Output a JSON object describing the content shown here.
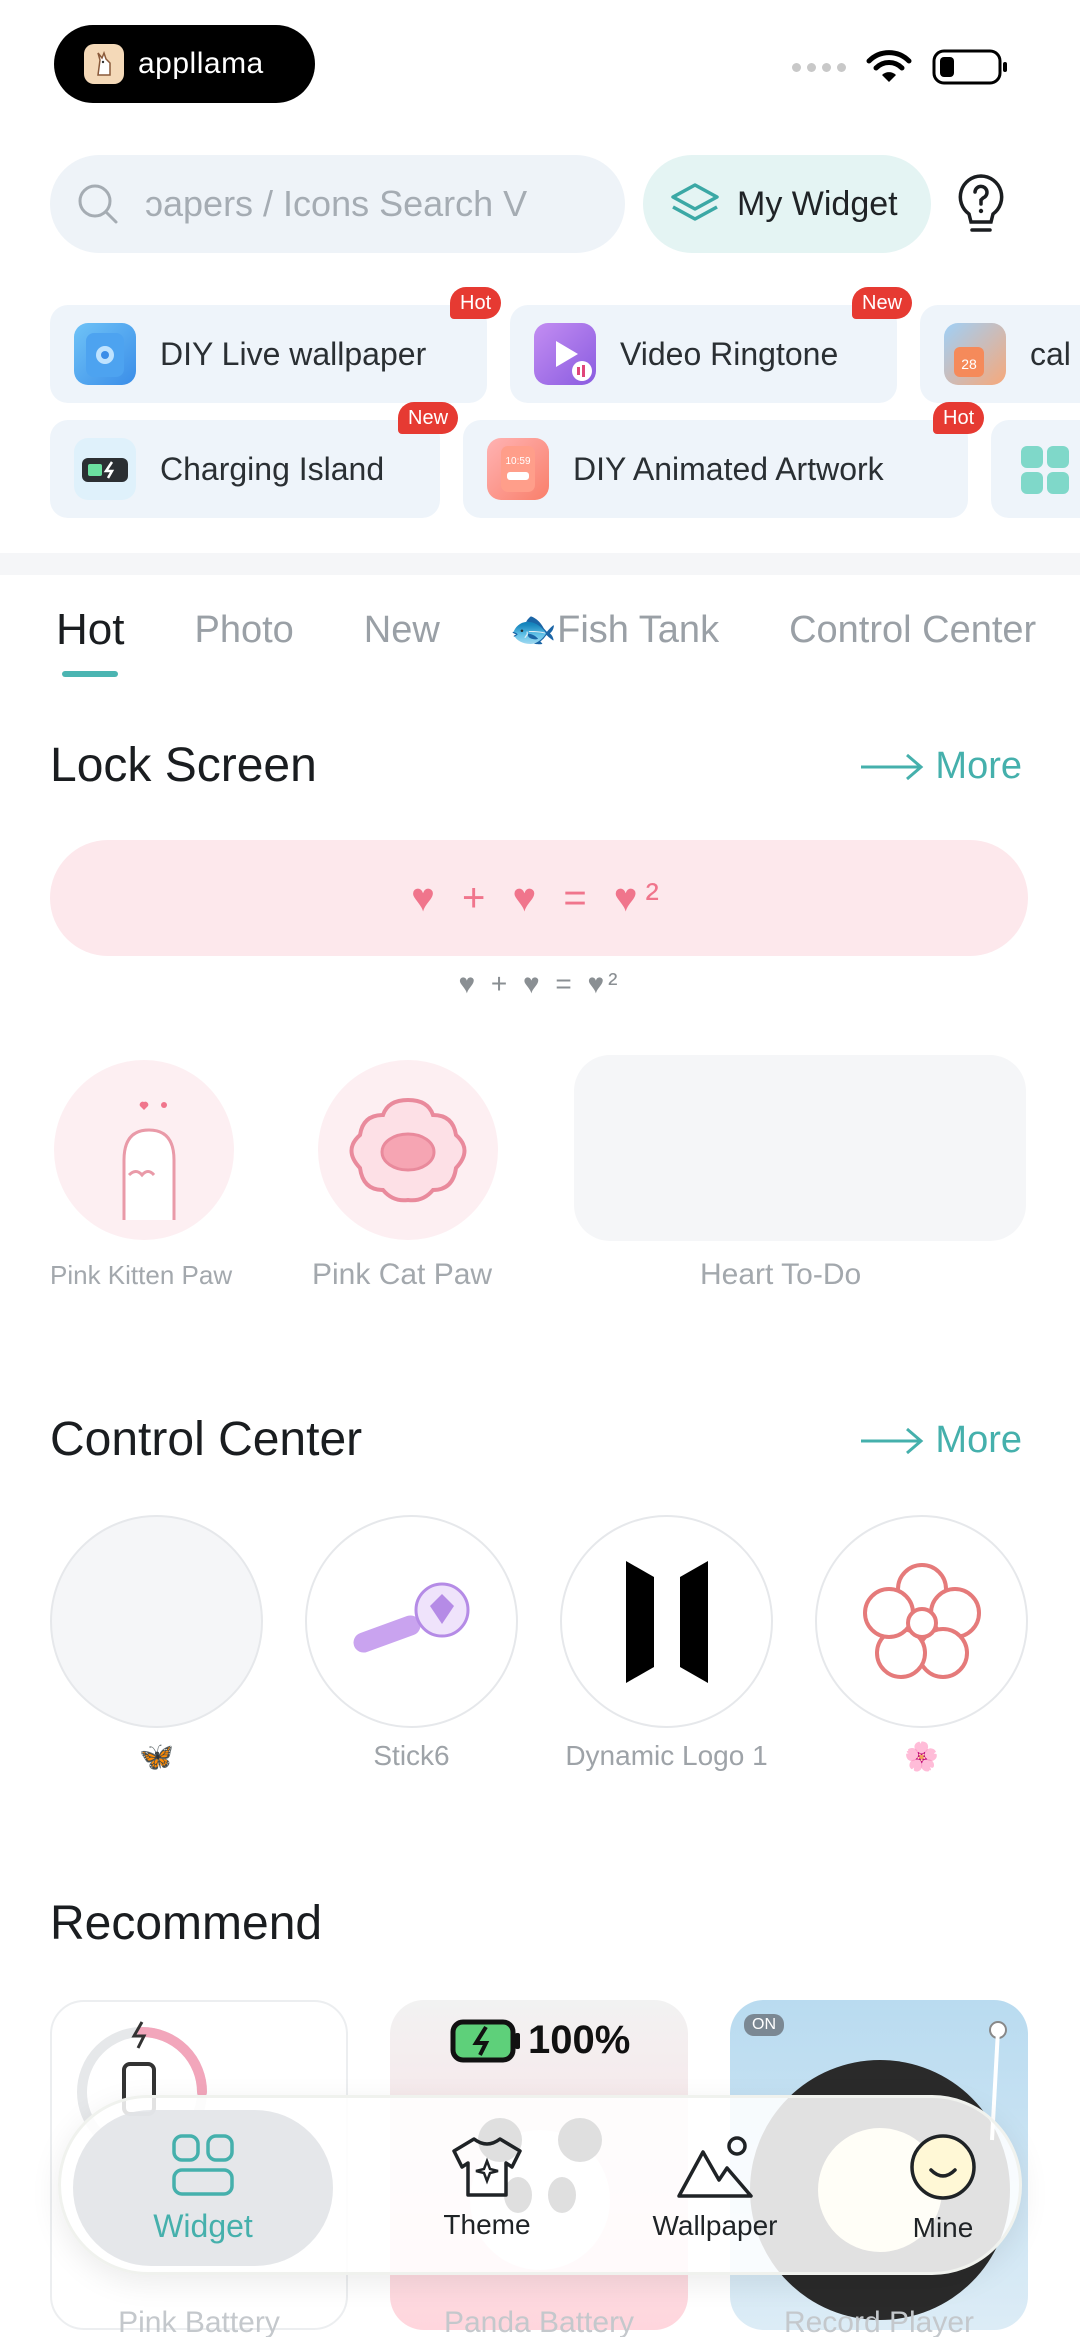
{
  "status_bar": {
    "app_name": "appllama"
  },
  "search": {
    "placeholder": "ɔapers / Icons      Search V"
  },
  "my_widget": {
    "label": "My Widget"
  },
  "features": [
    {
      "label": "DIY Live wallpaper",
      "badge": "Hot"
    },
    {
      "label": "Video Ringtone",
      "badge": "New"
    },
    {
      "label": "cal",
      "badge": ""
    },
    {
      "label": "Charging Island",
      "badge": "New"
    },
    {
      "label": "DIY Animated Artwork",
      "badge": "Hot"
    }
  ],
  "tabs": [
    {
      "label": "Hot",
      "active": true
    },
    {
      "label": "Photo"
    },
    {
      "label": "New"
    },
    {
      "label": "🐟Fish Tank"
    },
    {
      "label": "Control Center"
    }
  ],
  "lock_screen": {
    "title": "Lock Screen",
    "more": "More",
    "banner": "♥ + ♥ = ♥²",
    "banner_caption": "♥ + ♥ = ♥²",
    "items": [
      {
        "label": "Pink Kitten Paw"
      },
      {
        "label": "Pink Cat Paw"
      },
      {
        "label": "Heart To-Do"
      }
    ]
  },
  "control_center": {
    "title": "Control Center",
    "more": "More",
    "items": [
      {
        "label": "🦋"
      },
      {
        "label": "Stick6"
      },
      {
        "label": "Dynamic Logo 1"
      },
      {
        "label": "🌸"
      }
    ]
  },
  "recommend": {
    "title": "Recommend",
    "battery_text": "100%",
    "on_badge": "ON",
    "items": [
      {
        "label": "Pink Battery"
      },
      {
        "label": "Panda Battery"
      },
      {
        "label": "Record Player"
      }
    ]
  },
  "bottom_nav": [
    {
      "label": "Widget",
      "active": true
    },
    {
      "label": "Theme"
    },
    {
      "label": "Wallpaper"
    },
    {
      "label": "Mine"
    }
  ],
  "colors": {
    "accent": "#45b0ac",
    "badge_red": "#e63a32",
    "pink": "#f0758c"
  }
}
